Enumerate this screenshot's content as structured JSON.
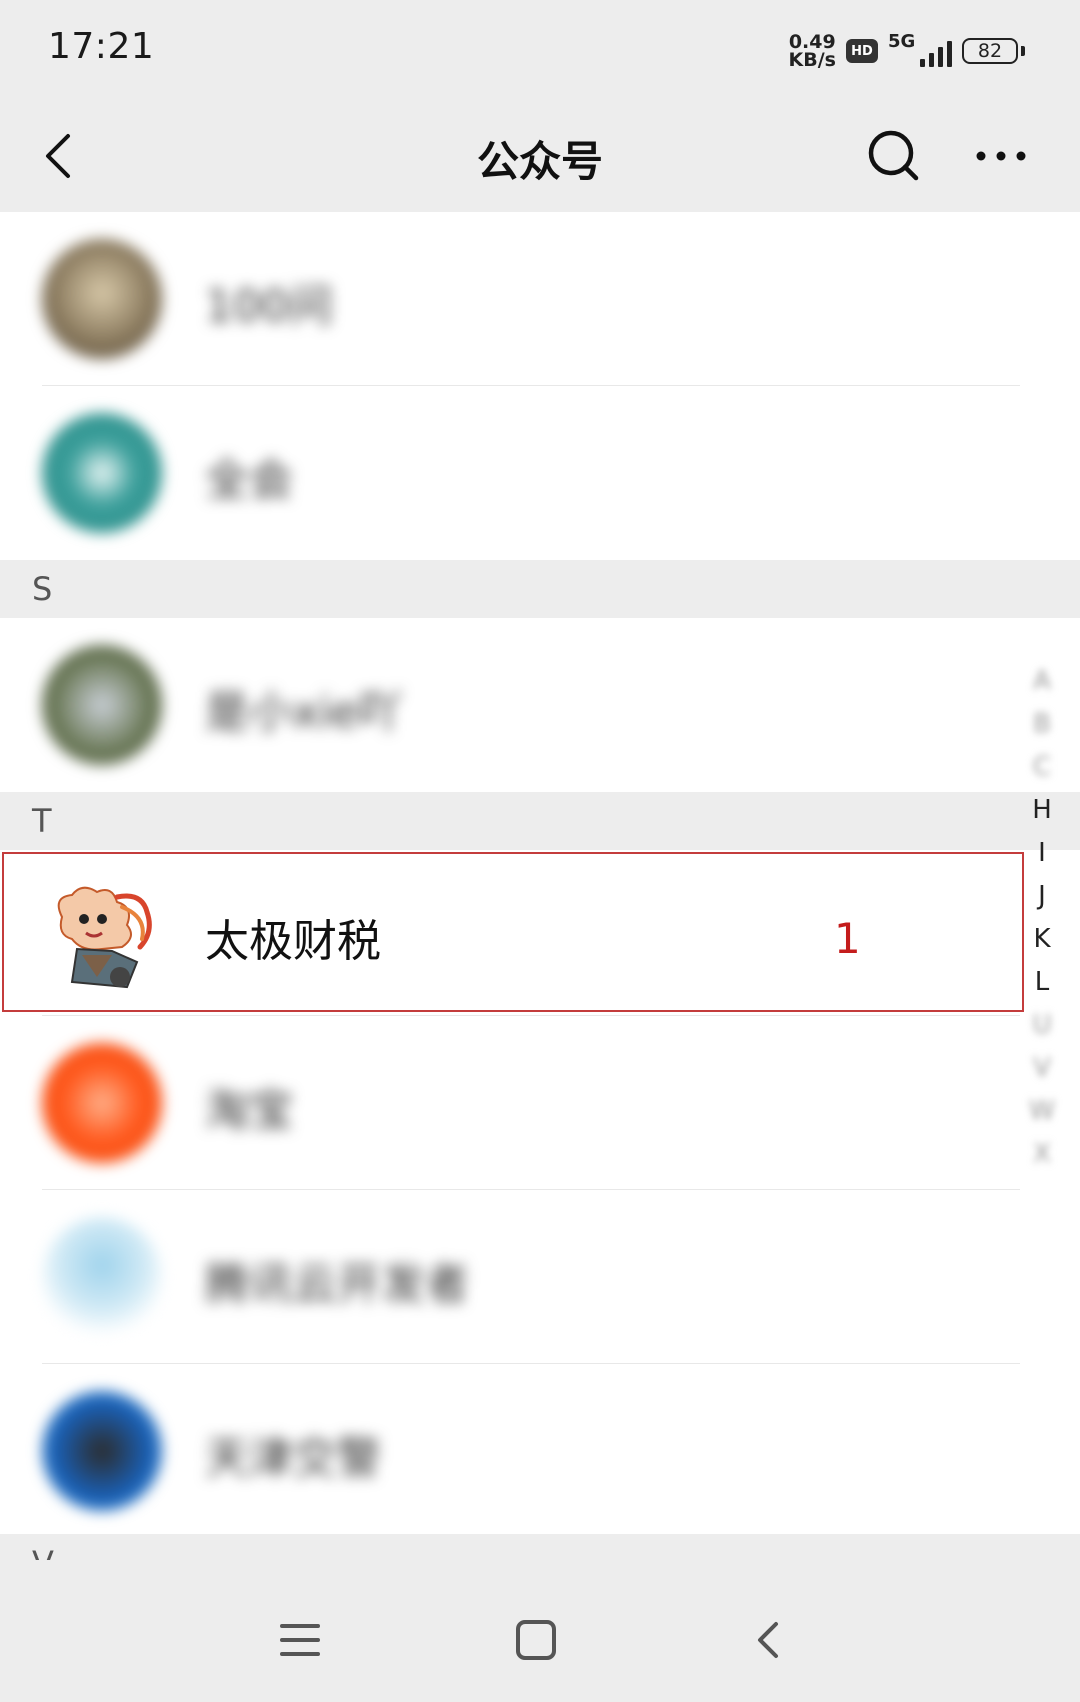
{
  "status_bar": {
    "time": "17:21",
    "net_speed_value": "0.49",
    "net_speed_unit": "KB/s",
    "hd_label": "HD",
    "network_label": "5G",
    "battery_level": "82"
  },
  "nav": {
    "title": "公众号",
    "back_icon": "back-chevron-icon",
    "search_icon": "search-icon",
    "more_icon": "more-dots-icon"
  },
  "list": {
    "rows_before_s": [
      {
        "name": "100问",
        "avatar_color": "#8a7a5e"
      },
      {
        "name": "全会",
        "avatar_color": "#3a9e9a"
      }
    ],
    "section_s": {
      "letter": "S",
      "rows": [
        {
          "name": "是小xie吖",
          "avatar_color": "#6d7b5a"
        }
      ]
    },
    "section_t": {
      "letter": "T",
      "highlighted": {
        "name": "太极财税",
        "annotation": "1"
      },
      "rows": [
        {
          "name": "淘宝",
          "avatar_color": "#ff5a1f"
        },
        {
          "name": "腾讯云开发者",
          "avatar_color": "#9fd3ec"
        },
        {
          "name": "天津交警",
          "avatar_color": "#1a5fb4"
        }
      ]
    },
    "section_v": {
      "letter": "V"
    }
  },
  "index_bar": {
    "letters": [
      "A",
      "B",
      "C",
      "H",
      "I",
      "J",
      "K",
      "L",
      "U",
      "V",
      "W",
      "X"
    ]
  },
  "system_nav": {
    "menu_icon": "menu-icon",
    "home_icon": "home-square-icon",
    "back_icon": "back-arrow-icon"
  },
  "colors": {
    "background": "#ededed",
    "row_background": "#ffffff",
    "highlight_border": "#c43c3c",
    "annotation_red": "#c41c1c"
  }
}
